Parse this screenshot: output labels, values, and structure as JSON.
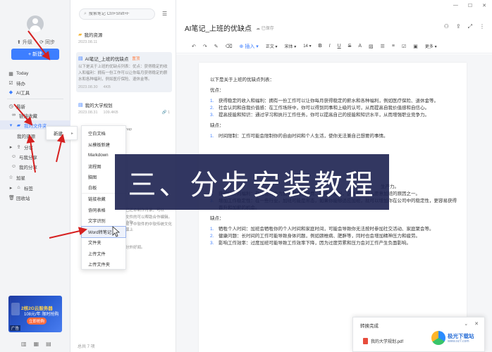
{
  "sidebar": {
    "upgrade": "升级",
    "sync": "同步",
    "new_button": "+ 新建",
    "items": [
      {
        "label": "Today",
        "icon": "calendar-icon"
      },
      {
        "label": "待办",
        "icon": "todo-icon"
      },
      {
        "label": "AI工具",
        "icon": "ai-icon"
      },
      {
        "label": "最新",
        "icon": "clock-icon"
      },
      {
        "label": "链接收藏",
        "icon": "link-icon"
      },
      {
        "label": "我的文件夹",
        "icon": "folder-icon"
      },
      {
        "label": "我的资源",
        "icon": "folder-icon"
      },
      {
        "label": "分享",
        "icon": "share-icon"
      },
      {
        "label": "与我分享",
        "icon": "user-icon"
      },
      {
        "label": "我的分享",
        "icon": "user-icon"
      },
      {
        "label": "加星",
        "icon": "star-icon"
      },
      {
        "label": "标签",
        "icon": "tag-icon"
      },
      {
        "label": "回收站",
        "icon": "trash-icon"
      }
    ],
    "ad": {
      "line1": "2核2G云服务器",
      "line2": "108元/年 限时抢购",
      "line3": "立即抢购",
      "tag": "广告"
    }
  },
  "notelist": {
    "search_placeholder": "搜索笔记 Ctrl+Shift+F",
    "notes": [
      {
        "title": "我的资源",
        "date": "2023.08.11"
      },
      {
        "title": "AI笔记_上班的优缺点",
        "badge": "置顶",
        "snippet": "以下是关于上班的优缺点列表：优点：获得稳定的收入和福利：拥有一份工作可以让你每月获得稳定的薪水和各种福利，例如医疗保险、退休金等。",
        "date": "2023.08.30",
        "size": "4KB"
      },
      {
        "title": "我的大学规划",
        "date": "2023.08.31",
        "size": "109.4KB",
        "shares": "1"
      }
    ],
    "fragments": [
      "nap",
      "已还本制作月录，可以",
      "文件的可以帮助合作编辑。中软",
      "以了中软件的中软传统文化保上",
      "分外好闻。"
    ],
    "footer": "总共 7 项"
  },
  "editor": {
    "title": "AI笔记_上班的优缺点",
    "saved": "已保存",
    "toolbar": {
      "insert": "插入",
      "text_style": "正文",
      "font": "宋体",
      "size": "14",
      "more": "更多"
    },
    "content": {
      "intro": "以下是关于上班的优缺点列表：",
      "pros_title": "优点：",
      "pros": [
        "获得稳定的收入和福利：拥有一份工作可以让你每月获得稳定的薪水和各种福利，例如医疗保险、退休金等。",
        "社会认同和自我价值感：在工作场所中，你可以得到同事和上级的认可，从而提高自我价值感和自信心。",
        "提高技能和知识：通过学习和执行工作任务，你可以提高自己的技能和知识水平，从而增强职业竞争力。"
      ],
      "cons_title": "缺点：",
      "cons": [
        "时间限制：工作可能会限制你的自由时间和个人生活，使你无法兼自己想要的事情。"
      ],
      "frag_line": "生产力。",
      "pros2": [
        "获得额外的福利：有些公司会为加班提供加班费、调休等福利，这也是一些人愿意加班的原因之一。",
        "增加工作稳定性：在一些行业，加班可能是常态，如果你能够适应加班，就可以增加你在公司中的稳定性，更容易获得晋升和加薪的机会。"
      ],
      "cons2_title": "缺点：",
      "cons2": [
        "牺牲个人时间：加班会牺牲你的个人时间和家庭时间，可能会导致你无法按时参加社交活动、家庭聚会等。",
        "健康问题：长时间的工作可能导致身体问题，例如颈椎病、肥胖等，同时也会增加精神压力和疲劳。",
        "影响工作效率：过度加班可能导致工作效率下降，因为过度劳累和压力会对工作产生负面影响。"
      ]
    }
  },
  "menu1": {
    "label": "新建"
  },
  "menu2": {
    "items": [
      "空白文档",
      "从模板新建",
      "Markdown",
      "流程图",
      "脑图",
      "白板",
      "链接收藏",
      "协同表格",
      "文字识别",
      "Word转笔记",
      "文件夹",
      "上传文件",
      "上传文件夹"
    ]
  },
  "banner": {
    "text": "三、分步安装教程"
  },
  "popup": {
    "title": "转换完成",
    "file": "我的大学规划.pdf"
  },
  "watermark": {
    "name": "极光下载站",
    "url": "www.xz7.com"
  },
  "colors": {
    "accent": "#3d7eff",
    "arrow": "#d62020",
    "banner": "#1c2150"
  }
}
